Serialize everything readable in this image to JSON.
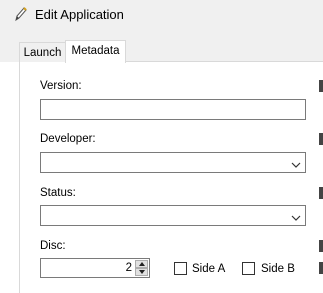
{
  "window": {
    "title": "Edit Application",
    "icon": "pencil-icon"
  },
  "tabs": [
    {
      "label": "Launch",
      "active": false
    },
    {
      "label": "Metadata",
      "active": true
    }
  ],
  "form": {
    "version": {
      "label": "Version:",
      "value": ""
    },
    "developer": {
      "label": "Developer:",
      "value": ""
    },
    "status": {
      "label": "Status:",
      "value": ""
    },
    "disc": {
      "label": "Disc:",
      "value": "2"
    },
    "side_a": {
      "label": "Side A",
      "checked": false
    },
    "side_b": {
      "label": "Side B",
      "checked": false
    }
  }
}
